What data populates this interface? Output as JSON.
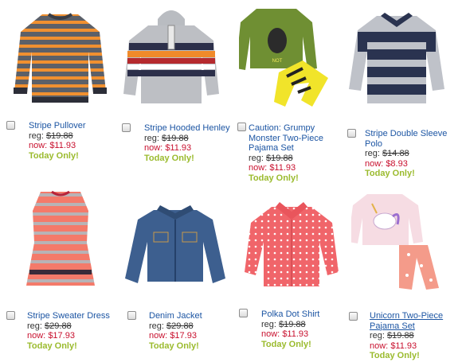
{
  "labels": {
    "reg": "reg:",
    "now": "now:",
    "today": "Today Only!"
  },
  "products": [
    {
      "name": "Stripe Pullover",
      "reg": "$19.88",
      "now": "$11.93",
      "underlined": false
    },
    {
      "name": "Stripe Hooded Henley",
      "reg": "$19.88",
      "now": "$11.93",
      "underlined": false
    },
    {
      "name": "Caution: Grumpy Monster Two-Piece Pajama Set",
      "reg": "$19.88",
      "now": "$11.93",
      "underlined": false
    },
    {
      "name": "Stripe Double Sleeve Polo",
      "reg": "$14.88",
      "now": "$8.93",
      "underlined": false
    },
    {
      "name": "Stripe Sweater Dress",
      "reg": "$29.88",
      "now": "$17.93",
      "underlined": false
    },
    {
      "name": "Denim Jacket",
      "reg": "$29.88",
      "now": "$17.93",
      "underlined": false
    },
    {
      "name": "Polka Dot Shirt",
      "reg": "$19.88",
      "now": "$11.93",
      "underlined": false
    },
    {
      "name": "Unicorn Two-Piece Pajama Set",
      "reg": "$19.88",
      "now": "$11.93",
      "underlined": true
    }
  ],
  "colors": {
    "link": "#1c55a3",
    "sale": "#c8102e",
    "promo": "#9bbb2e"
  }
}
